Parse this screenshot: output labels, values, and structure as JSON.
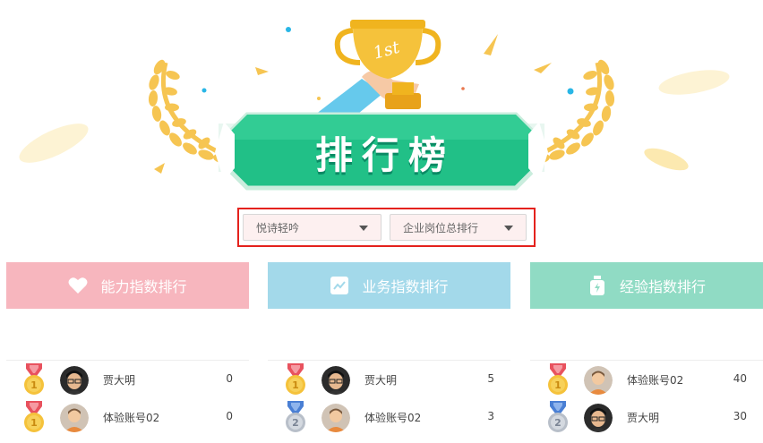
{
  "banner": {
    "title": "排行榜",
    "trophy_text": "1st",
    "colors": {
      "banner_green": "#21c087",
      "wreath": "#f6c552",
      "trophy": "#f0b41f"
    }
  },
  "filters": {
    "user_select": "悦诗轻吟",
    "ranking_select": "企业岗位总排行",
    "highlight_color": "#e4221d"
  },
  "cards": [
    {
      "title": "能力指数排行",
      "icon": "heart-icon",
      "color": "#f7b6be",
      "rows": [
        {
          "medal": "gold",
          "medal_num": "1",
          "avatar": "man-glasses-avatar",
          "name": "贾大明",
          "score": "0"
        },
        {
          "medal": "gold",
          "medal_num": "1",
          "avatar": "default-avatar",
          "name": "体验账号02",
          "score": "0"
        }
      ]
    },
    {
      "title": "业务指数排行",
      "icon": "trend-chart-icon",
      "color": "#a3d9ea",
      "rows": [
        {
          "medal": "gold",
          "medal_num": "1",
          "avatar": "man-glasses-avatar",
          "name": "贾大明",
          "score": "5"
        },
        {
          "medal": "silver",
          "medal_num": "2",
          "avatar": "default-avatar",
          "name": "体验账号02",
          "score": "3"
        }
      ]
    },
    {
      "title": "经验指数排行",
      "icon": "money-bag-icon",
      "color": "#90dbc4",
      "rows": [
        {
          "medal": "gold",
          "medal_num": "1",
          "avatar": "default-avatar",
          "name": "体验账号02",
          "score": "40"
        },
        {
          "medal": "silver",
          "medal_num": "2",
          "avatar": "man-glasses-avatar",
          "name": "贾大明",
          "score": "30"
        }
      ]
    }
  ]
}
